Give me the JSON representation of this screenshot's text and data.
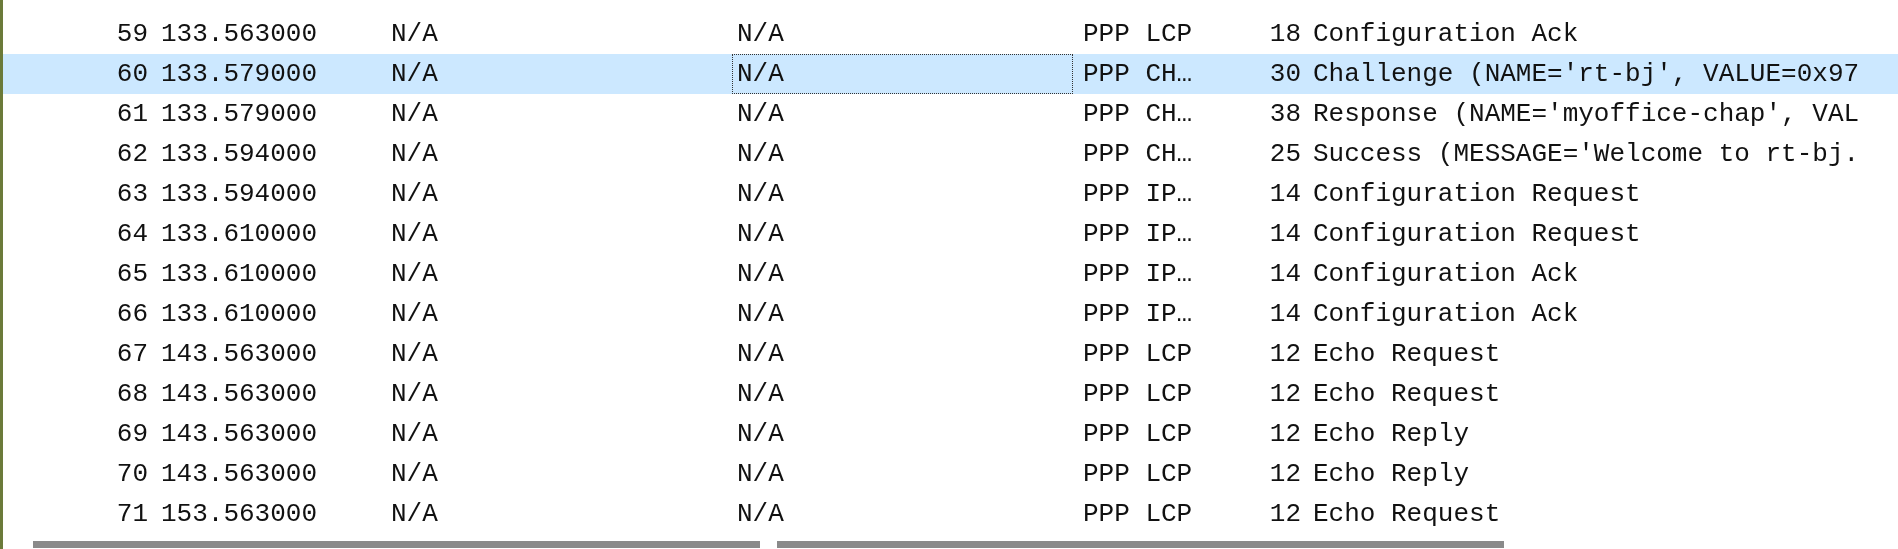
{
  "packet_list": {
    "rows": [
      {
        "no": "59",
        "time": "133.563000",
        "source": "N/A",
        "destination": "N/A",
        "protocol": "PPP LCP",
        "length": "18",
        "info": "Configuration Ack",
        "selected": false,
        "destination_focused": false
      },
      {
        "no": "60",
        "time": "133.579000",
        "source": "N/A",
        "destination": "N/A",
        "protocol": "PPP CH…",
        "length": "30",
        "info": "Challenge (NAME='rt-bj', VALUE=0x97",
        "selected": true,
        "destination_focused": true
      },
      {
        "no": "61",
        "time": "133.579000",
        "source": "N/A",
        "destination": "N/A",
        "protocol": "PPP CH…",
        "length": "38",
        "info": "Response (NAME='myoffice-chap', VAL",
        "selected": false,
        "destination_focused": false
      },
      {
        "no": "62",
        "time": "133.594000",
        "source": "N/A",
        "destination": "N/A",
        "protocol": "PPP CH…",
        "length": "25",
        "info": "Success (MESSAGE='Welcome to rt-bj.",
        "selected": false,
        "destination_focused": false
      },
      {
        "no": "63",
        "time": "133.594000",
        "source": "N/A",
        "destination": "N/A",
        "protocol": "PPP IP…",
        "length": "14",
        "info": "Configuration Request",
        "selected": false,
        "destination_focused": false
      },
      {
        "no": "64",
        "time": "133.610000",
        "source": "N/A",
        "destination": "N/A",
        "protocol": "PPP IP…",
        "length": "14",
        "info": "Configuration Request",
        "selected": false,
        "destination_focused": false
      },
      {
        "no": "65",
        "time": "133.610000",
        "source": "N/A",
        "destination": "N/A",
        "protocol": "PPP IP…",
        "length": "14",
        "info": "Configuration Ack",
        "selected": false,
        "destination_focused": false
      },
      {
        "no": "66",
        "time": "133.610000",
        "source": "N/A",
        "destination": "N/A",
        "protocol": "PPP IP…",
        "length": "14",
        "info": "Configuration Ack",
        "selected": false,
        "destination_focused": false
      },
      {
        "no": "67",
        "time": "143.563000",
        "source": "N/A",
        "destination": "N/A",
        "protocol": "PPP LCP",
        "length": "12",
        "info": "Echo Request",
        "selected": false,
        "destination_focused": false
      },
      {
        "no": "68",
        "time": "143.563000",
        "source": "N/A",
        "destination": "N/A",
        "protocol": "PPP LCP",
        "length": "12",
        "info": "Echo Request",
        "selected": false,
        "destination_focused": false
      },
      {
        "no": "69",
        "time": "143.563000",
        "source": "N/A",
        "destination": "N/A",
        "protocol": "PPP LCP",
        "length": "12",
        "info": "Echo Reply",
        "selected": false,
        "destination_focused": false
      },
      {
        "no": "70",
        "time": "143.563000",
        "source": "N/A",
        "destination": "N/A",
        "protocol": "PPP LCP",
        "length": "12",
        "info": "Echo Reply",
        "selected": false,
        "destination_focused": false
      },
      {
        "no": "71",
        "time": "153.563000",
        "source": "N/A",
        "destination": "N/A",
        "protocol": "PPP LCP",
        "length": "12",
        "info": "Echo Request",
        "selected": false,
        "destination_focused": false
      }
    ]
  }
}
